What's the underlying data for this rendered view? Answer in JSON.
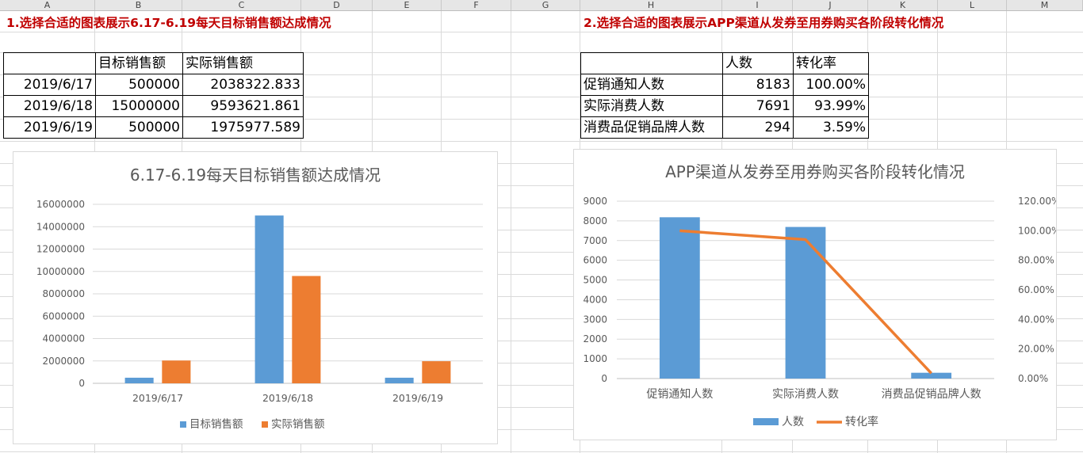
{
  "spreadsheet": {
    "columns": [
      "A",
      "B",
      "C",
      "D",
      "E",
      "F",
      "G",
      "H",
      "I",
      "J",
      "K",
      "L",
      "M"
    ]
  },
  "task1": {
    "title": "1.选择合适的图表展示6.17-6.19每天目标销售额达成情况",
    "table": {
      "headers": [
        "",
        "目标销售额",
        "实际销售额"
      ],
      "rows": [
        [
          "2019/6/17",
          "500000",
          "2038322.833"
        ],
        [
          "2019/6/18",
          "15000000",
          "9593621.861"
        ],
        [
          "2019/6/19",
          "500000",
          "1975977.589"
        ]
      ]
    }
  },
  "task2": {
    "title": "2.选择合适的图表展示APP渠道从发券至用券购买各阶段转化情况",
    "table": {
      "headers": [
        "",
        "人数",
        "转化率"
      ],
      "rows": [
        [
          "促销通知人数",
          "8183",
          "100.00%"
        ],
        [
          "实际消费人数",
          "7691",
          "93.99%"
        ],
        [
          "消费品促销品牌人数",
          "294",
          "3.59%"
        ]
      ]
    }
  },
  "chart_data": [
    {
      "type": "bar",
      "title": "6.17-6.19每天目标销售额达成情况",
      "categories": [
        "2019/6/17",
        "2019/6/18",
        "2019/6/19"
      ],
      "series": [
        {
          "name": "目标销售额",
          "values": [
            500000,
            15000000,
            500000
          ],
          "color": "#5b9bd5"
        },
        {
          "name": "实际销售额",
          "values": [
            2038322.833,
            9593621.861,
            1975977.589
          ],
          "color": "#ed7d31"
        }
      ],
      "ylim": [
        0,
        16000000
      ],
      "yticks": [
        "0",
        "2000000",
        "4000000",
        "6000000",
        "8000000",
        "10000000",
        "12000000",
        "14000000",
        "16000000"
      ],
      "grid": true,
      "legend": "bottom"
    },
    {
      "type": "bar",
      "title": "APP渠道从发券至用券购买各阶段转化情况",
      "categories": [
        "促销通知人数",
        "实际消费人数",
        "消费品促销品牌人数"
      ],
      "series": [
        {
          "name": "人数",
          "values": [
            8183,
            7691,
            294
          ],
          "color": "#5b9bd5",
          "kind": "bar",
          "axis": "left"
        },
        {
          "name": "转化率",
          "values": [
            1.0,
            0.9399,
            0.0359
          ],
          "color": "#ed7d31",
          "kind": "line",
          "axis": "right"
        }
      ],
      "ylim": [
        0,
        9000
      ],
      "yticks": [
        "0",
        "1000",
        "2000",
        "3000",
        "4000",
        "5000",
        "6000",
        "7000",
        "8000",
        "9000"
      ],
      "y2lim": [
        0,
        1.2
      ],
      "y2ticks": [
        "0.00%",
        "20.00%",
        "40.00%",
        "60.00%",
        "80.00%",
        "100.00%",
        "120.00%"
      ],
      "grid": true,
      "legend": "bottom"
    }
  ]
}
